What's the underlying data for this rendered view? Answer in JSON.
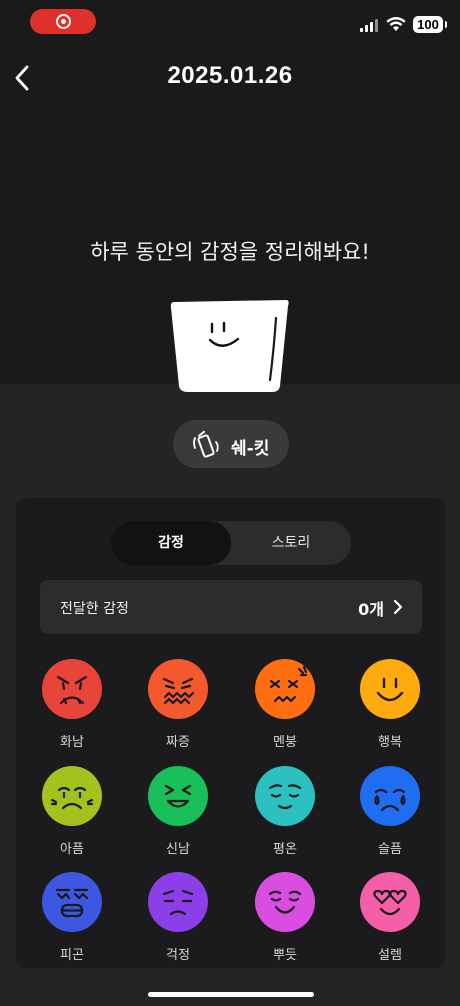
{
  "status_bar": {
    "battery": "100"
  },
  "header": {
    "title": "2025.01.26"
  },
  "headline": "하루 동안의 감정을 정리해봐요!",
  "shake_button": {
    "label": "쉐-킷"
  },
  "tabs": [
    {
      "label": "감정",
      "active": true
    },
    {
      "label": "스토리",
      "active": false
    }
  ],
  "sent_emotions": {
    "label": "전달한 감정",
    "count": "0개"
  },
  "emotions": [
    {
      "label": "화남",
      "color": "#e8443a"
    },
    {
      "label": "짜증",
      "color": "#f4582e"
    },
    {
      "label": "멘붕",
      "color": "#ff6f12"
    },
    {
      "label": "행복",
      "color": "#ffaa0f"
    },
    {
      "label": "아픔",
      "color": "#a4c21d"
    },
    {
      "label": "신남",
      "color": "#19c05a"
    },
    {
      "label": "평온",
      "color": "#2cc1c0"
    },
    {
      "label": "슬픔",
      "color": "#1f6ef2"
    },
    {
      "label": "피곤",
      "color": "#3d57e2"
    },
    {
      "label": "걱정",
      "color": "#8c3fe6"
    },
    {
      "label": "뿌듯",
      "color": "#d94ee0"
    },
    {
      "label": "설렘",
      "color": "#f55fa8"
    }
  ]
}
